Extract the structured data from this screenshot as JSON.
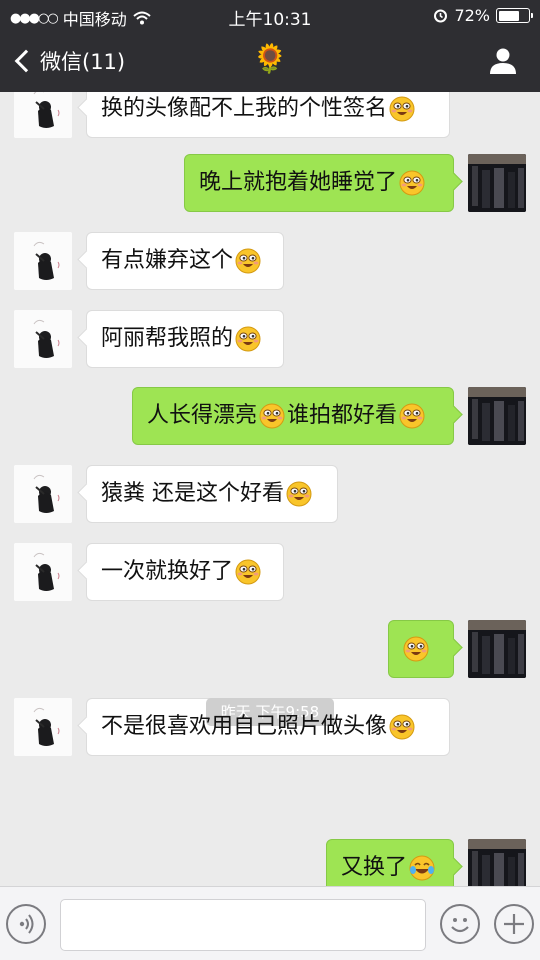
{
  "status_bar": {
    "signal_dots": "●●●○○",
    "carrier": "中国移动",
    "wifi_icon": "wifi-icon",
    "time": "上午10:31",
    "alarm_icon": "alarm-icon",
    "battery_percent": "72%",
    "battery_level": 0.72
  },
  "nav": {
    "back_label": "微信(11)",
    "title": "🌻",
    "profile_icon": "person-icon"
  },
  "messages": [
    {
      "side": "left",
      "text": "换的头像配不上我的个性签名",
      "emoji": "grin"
    },
    {
      "side": "right",
      "text": "晚上就抱着她睡觉了",
      "emoji": "grin"
    },
    {
      "side": "left",
      "text": "有点嫌弃这个",
      "emoji": "grin"
    },
    {
      "side": "left",
      "text": "阿丽帮我照的",
      "emoji": "grin"
    },
    {
      "side": "right",
      "text": "人长得漂亮",
      "emoji": "grin",
      "text2": "谁拍都好看",
      "emoji2": "grin"
    },
    {
      "side": "left",
      "text": "猿粪 还是这个好看",
      "emoji": "grin"
    },
    {
      "side": "left",
      "text": "一次就换好了",
      "emoji": "grin"
    },
    {
      "side": "right",
      "text": "",
      "emoji": "grin"
    },
    {
      "side": "left",
      "text": "不是很喜欢用自己照片做头像",
      "emoji": "grin"
    },
    {
      "side": "right",
      "text": "又换了",
      "emoji": "tears-of-joy"
    }
  ],
  "timestamp": "昨天 下午9:58",
  "input_bar": {
    "voice_icon": "voice-icon",
    "emoji_icon": "smiley-icon",
    "plus_icon": "plus-icon",
    "placeholder": ""
  },
  "colors": {
    "nav_bg": "#2e2e32",
    "chat_bg": "#ebebeb",
    "bubble_right": "#9ee453",
    "bubble_left": "#ffffff"
  }
}
